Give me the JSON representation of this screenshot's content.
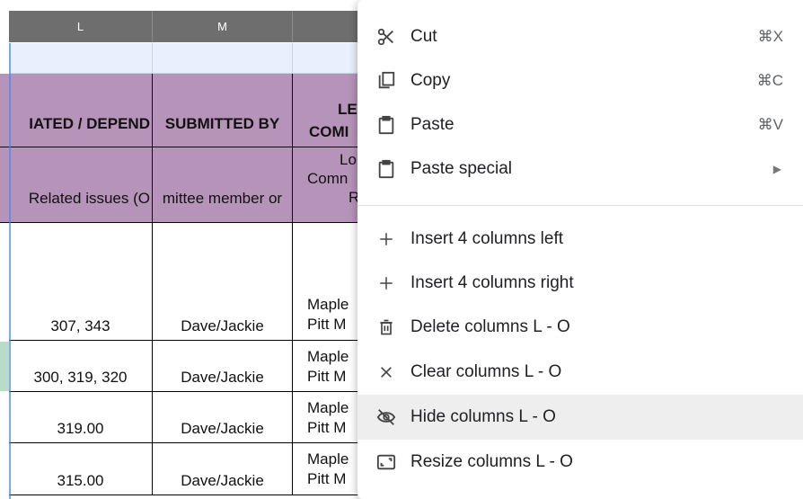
{
  "columns": {
    "l": "L",
    "m": "M"
  },
  "header": {
    "related": "IATED / DEPEND",
    "submitted": "SUBMITTED BY",
    "lead_top": "LE",
    "lead_bottom": "COMI"
  },
  "subheader": {
    "related": "Related issues (O",
    "submitted": "mittee member or",
    "lead_1": "Lo",
    "lead_2": "Comn",
    "lead_3": "R"
  },
  "rows": [
    {
      "related": "307, 343",
      "submitted": "Dave/Jackie",
      "lead_1": "Maple",
      "lead_2": "Pitt M"
    },
    {
      "related": "300, 319, 320",
      "submitted": "Dave/Jackie",
      "lead_1": "Maple",
      "lead_2": "Pitt M"
    },
    {
      "related": "319.00",
      "submitted": "Dave/Jackie",
      "lead_1": "Maple",
      "lead_2": "Pitt M"
    },
    {
      "related": "315.00",
      "submitted": "Dave/Jackie",
      "lead_1": "Maple",
      "lead_2": "Pitt M"
    }
  ],
  "menu": {
    "cut": {
      "label": "Cut",
      "shortcut": "⌘X"
    },
    "copy": {
      "label": "Copy",
      "shortcut": "⌘C"
    },
    "paste": {
      "label": "Paste",
      "shortcut": "⌘V"
    },
    "paste_special": {
      "label": "Paste special"
    },
    "insert_left": {
      "label": "Insert 4 columns left"
    },
    "insert_right": {
      "label": "Insert 4 columns right"
    },
    "delete": {
      "label": "Delete columns L - O"
    },
    "clear": {
      "label": "Clear columns L - O"
    },
    "hide": {
      "label": "Hide columns L - O"
    },
    "resize": {
      "label": "Resize columns L - O"
    }
  }
}
